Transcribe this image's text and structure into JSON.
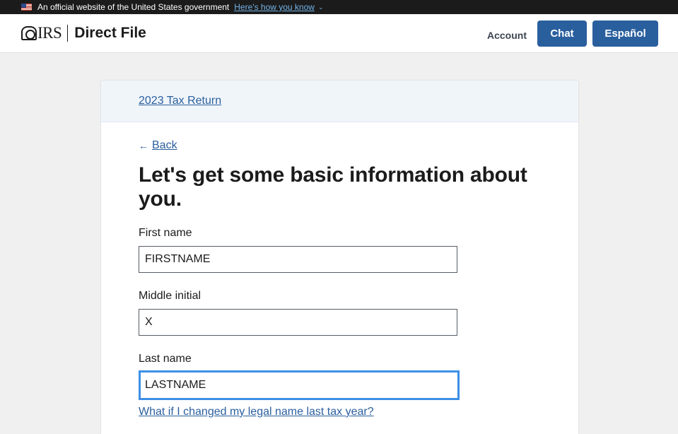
{
  "gov_banner": {
    "text": "An official website of the United States government",
    "link": "Here's how you know",
    "icon": "us-flag-icon"
  },
  "header": {
    "logo": "IRS",
    "product": "Direct File",
    "account": "Account",
    "chat": "Chat",
    "espanol": "Español"
  },
  "card": {
    "breadcrumb": "2023 Tax Return",
    "back": "Back",
    "title": "Let's get some basic information about you.",
    "fields": [
      {
        "label": "First name",
        "value": "FIRSTNAME"
      },
      {
        "label": "Middle initial",
        "value": "X"
      },
      {
        "label": "Last name",
        "value": "LASTNAME"
      }
    ],
    "help_link": "What if I changed my legal name last tax year?"
  },
  "colors": {
    "primary": "#2a5f9e",
    "focus": "#3d8fe6",
    "banner_bg": "#1b1b1b"
  }
}
